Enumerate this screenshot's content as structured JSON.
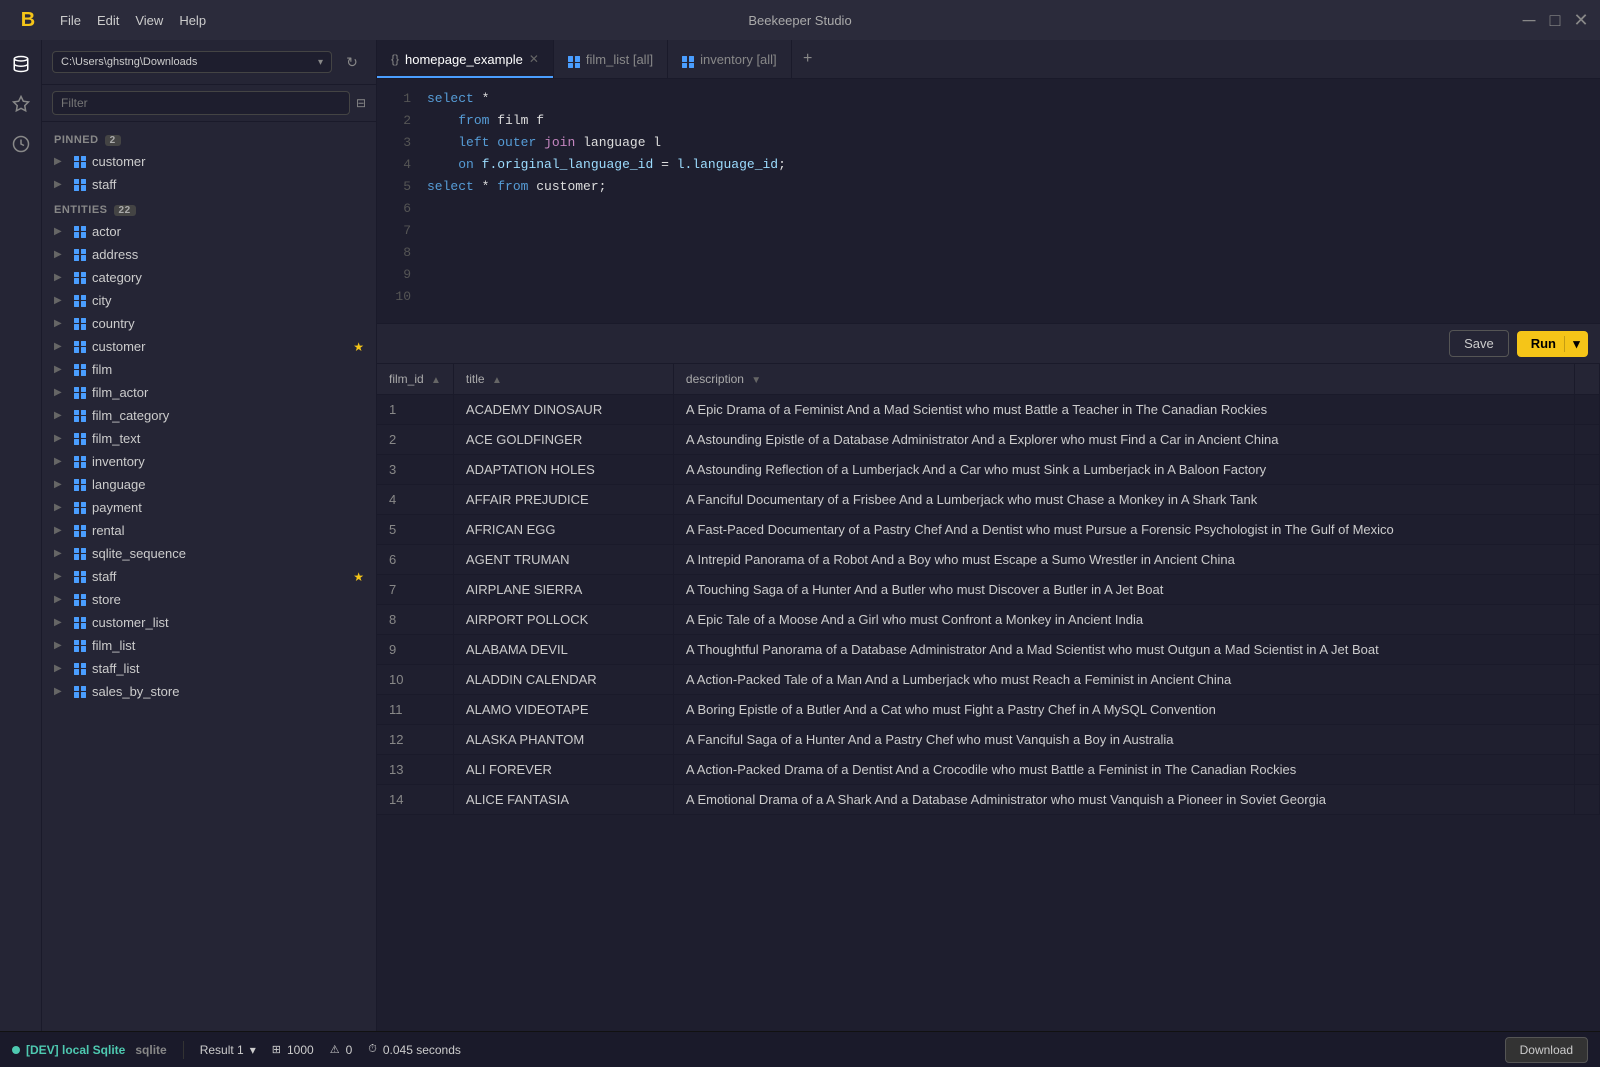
{
  "app": {
    "title": "Beekeeper Studio",
    "menu": [
      "File",
      "Edit",
      "View",
      "Help"
    ],
    "controls": [
      "─",
      "□",
      "✕"
    ]
  },
  "sidebar": {
    "path": "C:\\Users\\ghstng\\Downloads",
    "filter_placeholder": "Filter",
    "pinned_label": "PINNED",
    "pinned_count": "2",
    "pinned_items": [
      {
        "name": "customer",
        "starred": false
      },
      {
        "name": "staff",
        "starred": false
      }
    ],
    "entities_label": "ENTITIES",
    "entities_count": "22",
    "entities": [
      {
        "name": "actor"
      },
      {
        "name": "address"
      },
      {
        "name": "category"
      },
      {
        "name": "city"
      },
      {
        "name": "country"
      },
      {
        "name": "customer",
        "starred": true
      },
      {
        "name": "film"
      },
      {
        "name": "film_actor"
      },
      {
        "name": "film_category"
      },
      {
        "name": "film_text"
      },
      {
        "name": "inventory"
      },
      {
        "name": "language"
      },
      {
        "name": "payment"
      },
      {
        "name": "rental"
      },
      {
        "name": "sqlite_sequence"
      },
      {
        "name": "staff",
        "starred": true
      },
      {
        "name": "store"
      },
      {
        "name": "customer_list"
      },
      {
        "name": "film_list"
      },
      {
        "name": "staff_list"
      },
      {
        "name": "sales_by_store"
      }
    ]
  },
  "tabs": [
    {
      "label": "homepage_example",
      "type": "query",
      "active": true,
      "closeable": true
    },
    {
      "label": "film_list [all]",
      "type": "table",
      "active": false,
      "closeable": false
    },
    {
      "label": "inventory [all]",
      "type": "table",
      "active": false,
      "closeable": false
    }
  ],
  "editor": {
    "lines": [
      {
        "num": 1,
        "code": "select *"
      },
      {
        "num": 2,
        "code": "    from film f"
      },
      {
        "num": 3,
        "code": "    left outer join language l"
      },
      {
        "num": 4,
        "code": "    on f.original_language_id = l.language_id;"
      },
      {
        "num": 5,
        "code": "select * from customer;"
      },
      {
        "num": 6,
        "code": ""
      },
      {
        "num": 7,
        "code": ""
      },
      {
        "num": 8,
        "code": ""
      },
      {
        "num": 9,
        "code": ""
      },
      {
        "num": 10,
        "code": ""
      }
    ]
  },
  "toolbar": {
    "save_label": "Save",
    "run_label": "Run"
  },
  "table": {
    "columns": [
      {
        "key": "film_id",
        "label": "film_id",
        "sortable": true,
        "sort": "asc"
      },
      {
        "key": "title",
        "label": "title",
        "sortable": true,
        "sort": null
      },
      {
        "key": "description",
        "label": "description",
        "sortable": false,
        "sort": "desc"
      }
    ],
    "rows": [
      {
        "film_id": "1",
        "title": "ACADEMY DINOSAUR",
        "description": "A Epic Drama of a Feminist And a Mad Scientist who must Battle a Teacher in The Canadian Rockies"
      },
      {
        "film_id": "2",
        "title": "ACE GOLDFINGER",
        "description": "A Astounding Epistle of a Database Administrator And a Explorer who must Find a Car in Ancient China"
      },
      {
        "film_id": "3",
        "title": "ADAPTATION HOLES",
        "description": "A Astounding Reflection of a Lumberjack And a Car who must Sink a Lumberjack in A Baloon Factory"
      },
      {
        "film_id": "4",
        "title": "AFFAIR PREJUDICE",
        "description": "A Fanciful Documentary of a Frisbee And a Lumberjack who must Chase a Monkey in A Shark Tank"
      },
      {
        "film_id": "5",
        "title": "AFRICAN EGG",
        "description": "A Fast-Paced Documentary of a Pastry Chef And a Dentist who must Pursue a Forensic Psychologist in The Gulf of Mexico"
      },
      {
        "film_id": "6",
        "title": "AGENT TRUMAN",
        "description": "A Intrepid Panorama of a Robot And a Boy who must Escape a Sumo Wrestler in Ancient China"
      },
      {
        "film_id": "7",
        "title": "AIRPLANE SIERRA",
        "description": "A Touching Saga of a Hunter And a Butler who must Discover a Butler in A Jet Boat"
      },
      {
        "film_id": "8",
        "title": "AIRPORT POLLOCK",
        "description": "A Epic Tale of a Moose And a Girl who must Confront a Monkey in Ancient India"
      },
      {
        "film_id": "9",
        "title": "ALABAMA DEVIL",
        "description": "A Thoughtful Panorama of a Database Administrator And a Mad Scientist who must Outgun a Mad Scientist in A Jet Boat"
      },
      {
        "film_id": "10",
        "title": "ALADDIN CALENDAR",
        "description": "A Action-Packed Tale of a Man And a Lumberjack who must Reach a Feminist in Ancient China"
      },
      {
        "film_id": "11",
        "title": "ALAMO VIDEOTAPE",
        "description": "A Boring Epistle of a Butler And a Cat who must Fight a Pastry Chef in A MySQL Convention"
      },
      {
        "film_id": "12",
        "title": "ALASKA PHANTOM",
        "description": "A Fanciful Saga of a Hunter And a Pastry Chef who must Vanquish a Boy in Australia"
      },
      {
        "film_id": "13",
        "title": "ALI FOREVER",
        "description": "A Action-Packed Drama of a Dentist And a Crocodile who must Battle a Feminist in The Canadian Rockies"
      },
      {
        "film_id": "14",
        "title": "ALICE FANTASIA",
        "description": "A Emotional Drama of a A Shark And a Database Administrator who must Vanquish a Pioneer in Soviet Georgia"
      }
    ]
  },
  "statusbar": {
    "connection_label": "[DEV] local Sqlite",
    "db_type": "sqlite",
    "result_tab": "Result 1",
    "row_count": "1000",
    "warning_count": "0",
    "elapsed_time": "0.045 seconds",
    "download_label": "Download"
  }
}
